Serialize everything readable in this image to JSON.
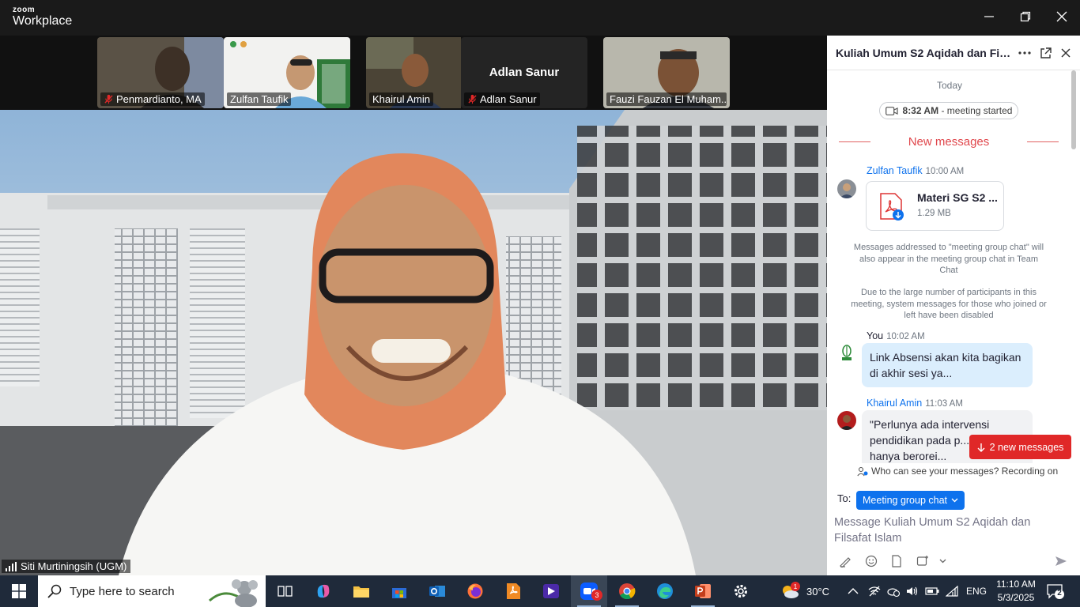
{
  "window": {
    "brand_top": "zoom",
    "brand_bottom": "Workplace"
  },
  "participants": [
    {
      "name": "Penmardianto, MA",
      "muted": true,
      "video": true
    },
    {
      "name": "Zulfan Taufik",
      "muted": false,
      "video": true
    },
    {
      "name": "Khairul Amin",
      "muted": false,
      "video": true
    },
    {
      "name": "Adlan Sanur",
      "display_name": "Adlan Sanur",
      "muted": true,
      "video": false
    },
    {
      "name": "Fauzi Fauzan El Muham...",
      "muted": false,
      "video": true
    }
  ],
  "active_speaker": {
    "name": "Siti Murtiningsih (UGM)"
  },
  "chat": {
    "title": "Kuliah Umum S2 Aqidah dan Filsafat Islam",
    "day_label": "Today",
    "meeting_started": {
      "time": "8:32 AM",
      "text": "- meeting started"
    },
    "new_messages_label": "New messages",
    "messages": [
      {
        "sender": "Zulfan Taufik",
        "time": "10:00 AM",
        "file": {
          "name": "Materi SG S2 ...",
          "size": "1.29 MB"
        }
      },
      {
        "sender": "You",
        "time": "10:02 AM",
        "text": "Link Absensi akan kita bagikan di akhir sesi ya..."
      },
      {
        "sender": "Khairul Amin",
        "time": "11:03 AM",
        "text": "\"Perlunya ada intervensi pendidikan pada p... yang hanya berorei..."
      }
    ],
    "system_messages": [
      "Messages addressed to \"meeting group chat\" will also appear in the meeting group chat in Team Chat",
      "Due to the large number of participants in this meeting, system messages for those who joined or left have been disabled"
    ],
    "new_messages_button": "2 new messages",
    "visibility_notice": "Who can see your messages? Recording on",
    "to_label": "To:",
    "recipient": "Meeting group chat",
    "input_placeholder": "Message Kuliah Umum S2 Aqidah dan Filsafat Islam"
  },
  "taskbar": {
    "search_placeholder": "Type here to search",
    "zoom_badge": "3",
    "weather": "30°C",
    "weather_badge": "1",
    "language": "ENG",
    "time": "11:10 AM",
    "date": "5/3/2025",
    "notification_count": "2"
  }
}
